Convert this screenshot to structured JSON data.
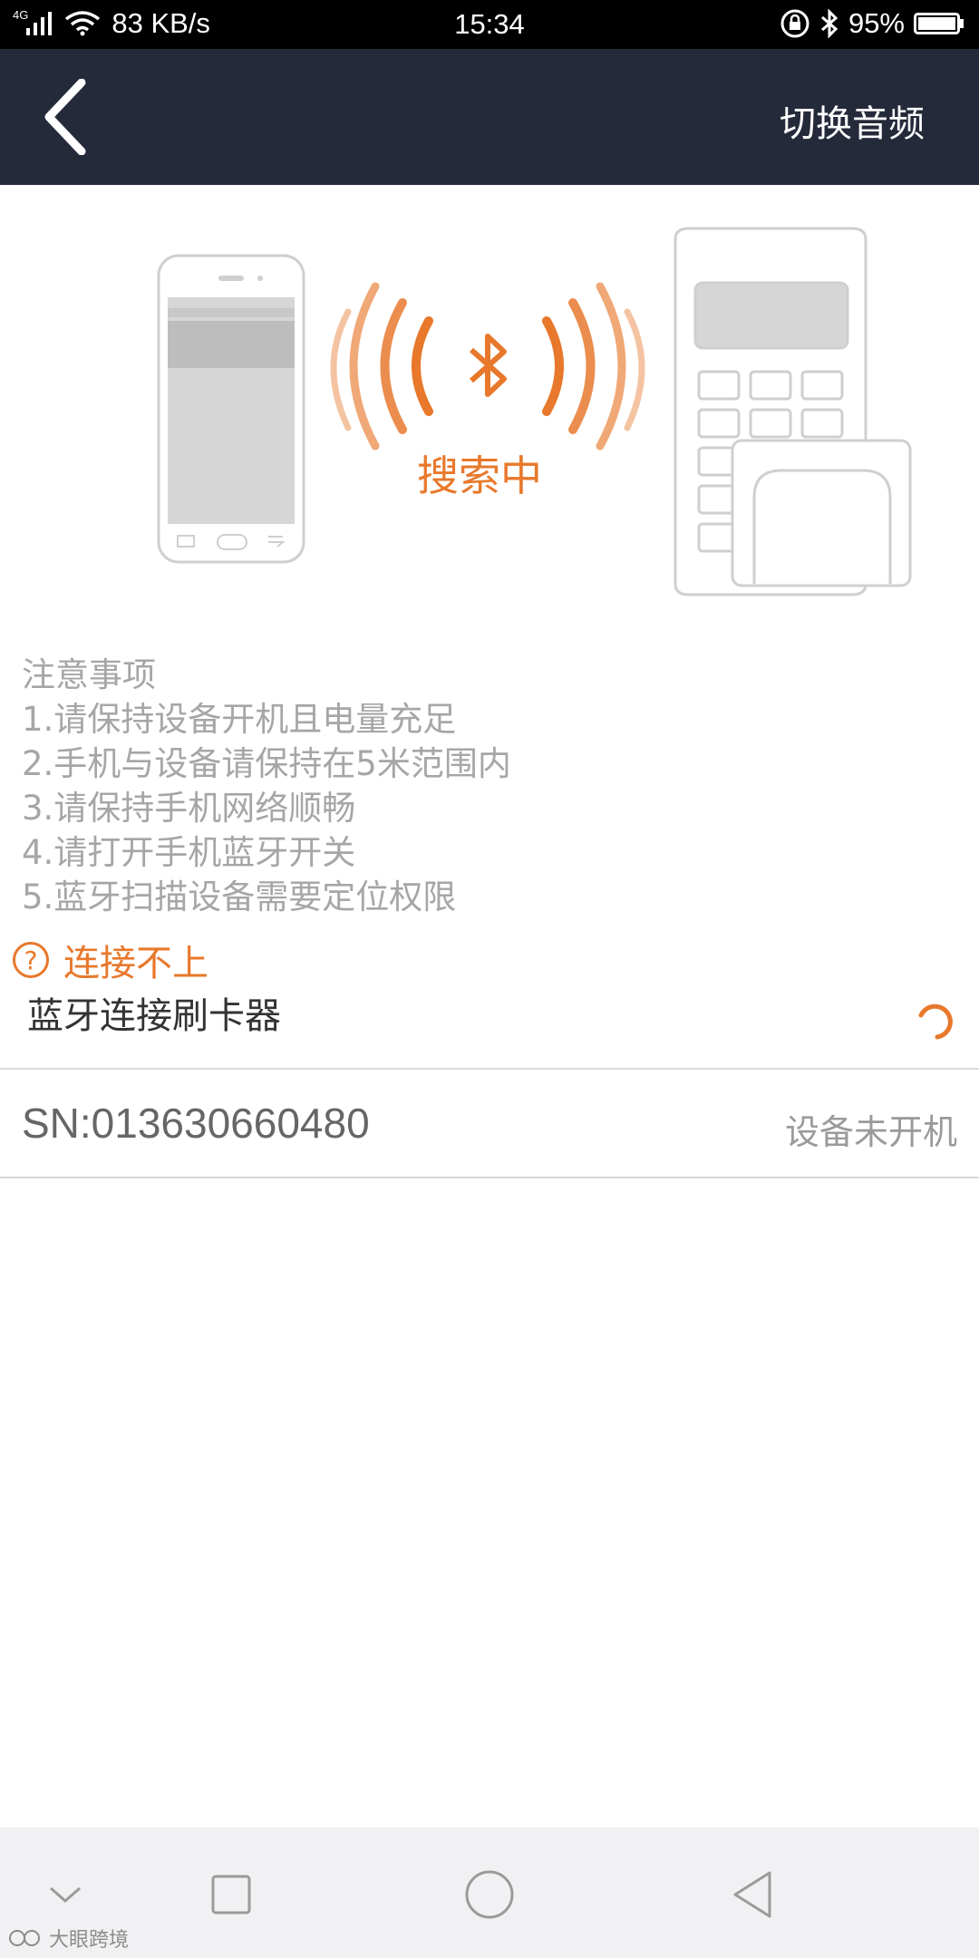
{
  "status_bar": {
    "network_type": "4G",
    "speed": "83 KB/s",
    "time": "15:34",
    "battery": "95%"
  },
  "header": {
    "back_icon": "chevron-left-icon",
    "switch_label": "切换音频"
  },
  "illustration": {
    "status_text": "搜索中",
    "accent_color": "#e8782b"
  },
  "notes": {
    "title": "注意事项",
    "items": [
      "1.请保持设备开机且电量充足",
      "2.手机与设备请保持在5米范围内",
      "3.请保持手机网络顺畅",
      "4.请打开手机蓝牙开关",
      "5.蓝牙扫描设备需要定位权限"
    ]
  },
  "help": {
    "icon": "?",
    "label": "连接不上"
  },
  "bluetooth": {
    "section_label": "蓝牙连接刷卡器"
  },
  "device": {
    "sn": "SN:013630660480",
    "status": "设备未开机"
  },
  "watermark": {
    "text": "大眼跨境"
  }
}
